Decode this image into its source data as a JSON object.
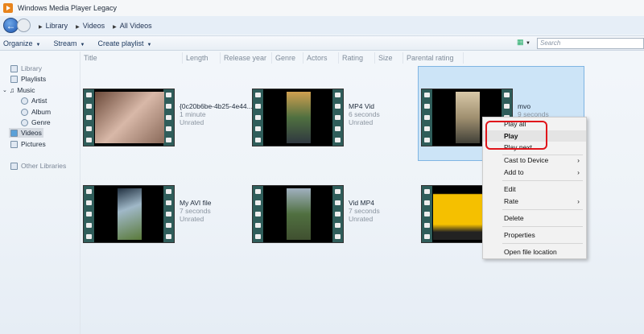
{
  "window": {
    "title": "Windows Media Player Legacy"
  },
  "breadcrumb": [
    "Library",
    "Videos",
    "All Videos"
  ],
  "toolbar": {
    "organize": "Organize",
    "stream": "Stream",
    "create_playlist": "Create playlist",
    "search_placeholder": "Search"
  },
  "columns": [
    "Title",
    "Length",
    "Release year",
    "Genre",
    "Actors",
    "Rating",
    "Size",
    "Parental rating"
  ],
  "sidebar": {
    "library": "Library",
    "playlists": "Playlists",
    "music": "Music",
    "artist": "Artist",
    "album": "Album",
    "genre": "Genre",
    "videos": "Videos",
    "pictures": "Pictures",
    "other": "Other Libraries"
  },
  "videos": [
    {
      "title": "{0c20b6be-4b25-4e44...",
      "length": "1 minute",
      "rating": "Unrated"
    },
    {
      "title": "MP4 Vid",
      "length": "6 seconds",
      "rating": "Unrated"
    },
    {
      "title": "mvo",
      "length": "9 seconds",
      "rating": ""
    },
    {
      "title": "My AVI file",
      "length": "7 seconds",
      "rating": "Unrated"
    },
    {
      "title": "Vid MP4",
      "length": "7 seconds",
      "rating": "Unrated"
    },
    {
      "title": "",
      "length": "",
      "rating": ""
    }
  ],
  "context_menu": [
    "Play all",
    "Play",
    "Play next",
    "Cast to Device",
    "Add to",
    "Edit",
    "Rate",
    "Delete",
    "Properties",
    "Open file location"
  ],
  "colors": {
    "highlight": "#e0151b",
    "selection": "#cce4f7"
  }
}
